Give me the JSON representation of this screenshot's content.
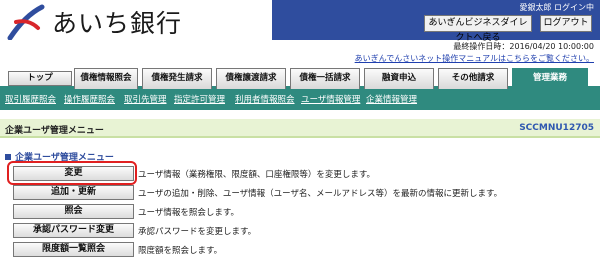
{
  "header": {
    "bank_name": "あいち銀行",
    "user": "愛銀太郎 ログイン中",
    "direct_button": "あいぎんビジネスダイレクトへ戻る",
    "logout_button": "ログアウト",
    "last_operation": "最終操作日時：2016/04/20 10:00:00",
    "manual_link": "あいぎんでんさいネット操作マニュアルはこちらをご覧ください。",
    "colors": {
      "panel": "#2f4d9e",
      "accent": "#2f8a7f"
    }
  },
  "tabs": [
    {
      "label": "トップ"
    },
    {
      "label": "債権情報照会"
    },
    {
      "label": "債権発生請求"
    },
    {
      "label": "債権譲渡請求"
    },
    {
      "label": "債権一括請求"
    },
    {
      "label": "融資申込"
    },
    {
      "label": "その他請求"
    },
    {
      "label": "管理業務",
      "active": true
    }
  ],
  "submenu": [
    "取引履歴照会",
    "操作履歴照会",
    "取引先管理",
    "指定許可管理",
    "利用者情報照会",
    "ユーザ情報管理",
    "企業情報管理"
  ],
  "page": {
    "title": "企業ユーザ管理メニュー",
    "code": "SCCMNU12705",
    "section_title": "企業ユーザ管理メニュー"
  },
  "menu": [
    {
      "button": "変更",
      "desc": "ユーザ情報（業務権限、限度額、口座権限等）を変更します。"
    },
    {
      "button": "追加・更新",
      "desc": "ユーザの追加・削除、ユーザ情報（ユーザ名、メールアドレス等）を最新の情報に更新します。"
    },
    {
      "button": "照会",
      "desc": "ユーザ情報を照会します。"
    },
    {
      "button": "承認パスワード変更",
      "desc": "承認パスワードを変更します。"
    },
    {
      "button": "限度額一覧照会",
      "desc": "限度額を照会します。"
    }
  ]
}
